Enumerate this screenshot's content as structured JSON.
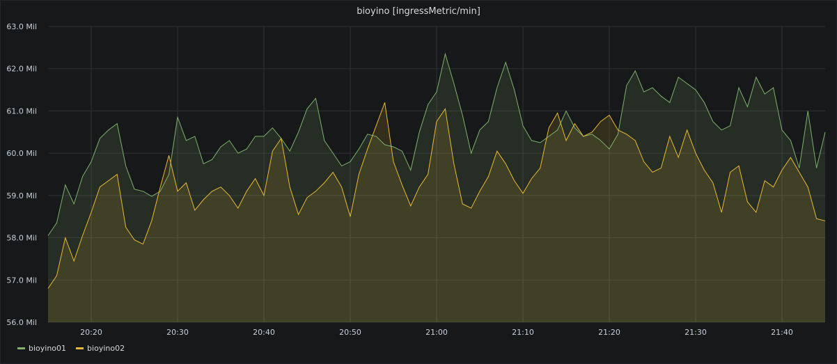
{
  "panel": {
    "title": "bioyino [ingressMetric/min]"
  },
  "chart_data": {
    "type": "area",
    "title": "bioyino [ingressMetric/min]",
    "xlabel": "",
    "ylabel": "",
    "x_start": "20:15",
    "x_end": "21:45",
    "ylim": [
      56.0,
      63.0
    ],
    "y_ticks": [
      56.0,
      57.0,
      58.0,
      59.0,
      60.0,
      61.0,
      62.0,
      63.0
    ],
    "y_tick_labels": [
      "56.0 Mil",
      "57.0 Mil",
      "58.0 Mil",
      "59.0 Mil",
      "60.0 Mil",
      "61.0 Mil",
      "62.0 Mil",
      "63.0 Mil"
    ],
    "x_ticks": [
      "20:20",
      "20:30",
      "20:40",
      "20:50",
      "21:00",
      "21:10",
      "21:20",
      "21:30",
      "21:40"
    ],
    "grid": true,
    "legend_position": "bottom-left",
    "series": [
      {
        "name": "bioyino01",
        "color": "#7eb26d",
        "x": [
          "20:15",
          "20:16",
          "20:17",
          "20:18",
          "20:19",
          "20:20",
          "20:21",
          "20:22",
          "20:23",
          "20:24",
          "20:25",
          "20:26",
          "20:27",
          "20:28",
          "20:29",
          "20:30",
          "20:31",
          "20:32",
          "20:33",
          "20:34",
          "20:35",
          "20:36",
          "20:37",
          "20:38",
          "20:39",
          "20:40",
          "20:41",
          "20:42",
          "20:43",
          "20:44",
          "20:45",
          "20:46",
          "20:47",
          "20:48",
          "20:49",
          "20:50",
          "20:51",
          "20:52",
          "20:53",
          "20:54",
          "20:55",
          "20:56",
          "20:57",
          "20:58",
          "20:59",
          "21:00",
          "21:01",
          "21:02",
          "21:03",
          "21:04",
          "21:05",
          "21:06",
          "21:07",
          "21:08",
          "21:09",
          "21:10",
          "21:11",
          "21:12",
          "21:13",
          "21:14",
          "21:15",
          "21:16",
          "21:17",
          "21:18",
          "21:19",
          "21:20",
          "21:21",
          "21:22",
          "21:23",
          "21:24",
          "21:25",
          "21:26",
          "21:27",
          "21:28",
          "21:29",
          "21:30",
          "21:31",
          "21:32",
          "21:33",
          "21:34",
          "21:35",
          "21:36",
          "21:37",
          "21:38",
          "21:39",
          "21:40",
          "21:41",
          "21:42",
          "21:43",
          "21:44",
          "21:45"
        ],
        "values": [
          58.05,
          58.35,
          59.25,
          58.8,
          59.45,
          59.8,
          60.35,
          60.55,
          60.7,
          59.7,
          59.15,
          59.1,
          58.98,
          59.1,
          59.5,
          60.85,
          60.3,
          60.4,
          59.75,
          59.85,
          60.15,
          60.3,
          60.0,
          60.1,
          60.4,
          60.4,
          60.6,
          60.35,
          60.05,
          60.5,
          61.05,
          61.3,
          60.3,
          60.0,
          59.7,
          59.8,
          60.1,
          60.45,
          60.4,
          60.2,
          60.15,
          60.05,
          59.6,
          60.5,
          61.15,
          61.45,
          62.35,
          61.65,
          60.9,
          60.0,
          60.55,
          60.75,
          61.55,
          62.15,
          61.5,
          60.65,
          60.3,
          60.25,
          60.4,
          60.55,
          61.0,
          60.6,
          60.4,
          60.45,
          60.3,
          60.1,
          60.45,
          61.6,
          61.95,
          61.45,
          61.55,
          61.35,
          61.2,
          61.8,
          61.65,
          61.5,
          61.2,
          60.75,
          60.55,
          60.65,
          61.55,
          61.1,
          61.8,
          61.4,
          61.55,
          60.55,
          60.3,
          59.65,
          61.0,
          59.65,
          60.5
        ]
      },
      {
        "name": "bioyino02",
        "color": "#eab839",
        "x": [
          "20:15",
          "20:16",
          "20:17",
          "20:18",
          "20:19",
          "20:20",
          "20:21",
          "20:22",
          "20:23",
          "20:24",
          "20:25",
          "20:26",
          "20:27",
          "20:28",
          "20:29",
          "20:30",
          "20:31",
          "20:32",
          "20:33",
          "20:34",
          "20:35",
          "20:36",
          "20:37",
          "20:38",
          "20:39",
          "20:40",
          "20:41",
          "20:42",
          "20:43",
          "20:44",
          "20:45",
          "20:46",
          "20:47",
          "20:48",
          "20:49",
          "20:50",
          "20:51",
          "20:52",
          "20:53",
          "20:54",
          "20:55",
          "20:56",
          "20:57",
          "20:58",
          "20:59",
          "21:00",
          "21:01",
          "21:02",
          "21:03",
          "21:04",
          "21:05",
          "21:06",
          "21:07",
          "21:08",
          "21:09",
          "21:10",
          "21:11",
          "21:12",
          "21:13",
          "21:14",
          "21:15",
          "21:16",
          "21:17",
          "21:18",
          "21:19",
          "21:20",
          "21:21",
          "21:22",
          "21:23",
          "21:24",
          "21:25",
          "21:26",
          "21:27",
          "21:28",
          "21:29",
          "21:30",
          "21:31",
          "21:32",
          "21:33",
          "21:34",
          "21:35",
          "21:36",
          "21:37",
          "21:38",
          "21:39",
          "21:40",
          "21:41",
          "21:42",
          "21:43",
          "21:44",
          "21:45"
        ],
        "values": [
          56.8,
          57.1,
          58.0,
          57.45,
          58.05,
          58.6,
          59.2,
          59.35,
          59.5,
          58.25,
          57.95,
          57.85,
          58.4,
          59.2,
          59.95,
          59.1,
          59.3,
          58.65,
          58.9,
          59.1,
          59.2,
          59.0,
          58.7,
          59.1,
          59.4,
          59.0,
          60.05,
          60.35,
          59.2,
          58.55,
          58.95,
          59.1,
          59.3,
          59.55,
          59.2,
          58.5,
          59.5,
          60.1,
          60.65,
          61.2,
          59.8,
          59.25,
          58.75,
          59.2,
          59.5,
          60.75,
          61.05,
          59.75,
          58.8,
          58.7,
          59.1,
          59.45,
          60.05,
          59.75,
          59.35,
          59.05,
          59.4,
          59.65,
          60.6,
          60.95,
          60.3,
          60.7,
          60.4,
          60.5,
          60.75,
          60.9,
          60.55,
          60.45,
          60.3,
          59.8,
          59.55,
          59.65,
          60.4,
          59.9,
          60.55,
          60.0,
          59.6,
          59.3,
          58.6,
          59.55,
          59.7,
          58.85,
          58.6,
          59.35,
          59.2,
          59.6,
          59.9,
          59.55,
          59.2,
          58.45,
          58.4
        ]
      }
    ]
  }
}
